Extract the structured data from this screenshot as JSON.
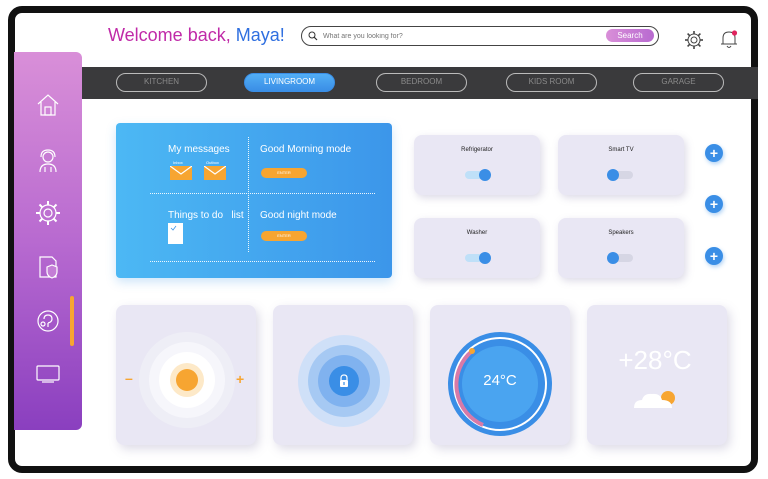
{
  "header": {
    "welcome_prefix": "Welcome back,",
    "user_name": "Maya!",
    "search_placeholder": "What are you looking for?",
    "search_button": "Search"
  },
  "tabs": [
    {
      "label": "KITCHEN",
      "active": false
    },
    {
      "label": "LIVINGROOM",
      "active": true
    },
    {
      "label": "BEDROOM",
      "active": false
    },
    {
      "label": "KIDS ROOM",
      "active": false
    },
    {
      "label": "GARAGE",
      "active": false
    }
  ],
  "sidebar": {
    "icons": [
      "home-icon",
      "user-icon",
      "settings-icon",
      "security-icon",
      "support-icon",
      "tv-icon"
    ],
    "active_index": 4
  },
  "modes": {
    "messages_title": "My messages",
    "inbox_label": "Inbox",
    "outbox_label": "Outbox",
    "todo_title": "Things to do   list",
    "morning_title": "Good Morning mode",
    "night_title": "Good night mode",
    "enter_label": "ENTER"
  },
  "devices": [
    {
      "label": "Refrigerator",
      "on": true
    },
    {
      "label": "Smart TV",
      "on": false
    },
    {
      "label": "Washer",
      "on": true
    },
    {
      "label": "Speakers",
      "on": false
    }
  ],
  "add_buttons": [
    "+",
    "+",
    "+"
  ],
  "light": {
    "minus": "–",
    "plus": "+"
  },
  "thermostat": {
    "value": "24°C"
  },
  "weather": {
    "value": "+28°C"
  },
  "colors": {
    "accent_blue": "#3a8ee6",
    "accent_orange": "#f7a531",
    "sidebar_top": "#d98fd8",
    "sidebar_bottom": "#8a3fbf",
    "welcome": "#c02aa8",
    "user_name": "#2f6fe0"
  }
}
